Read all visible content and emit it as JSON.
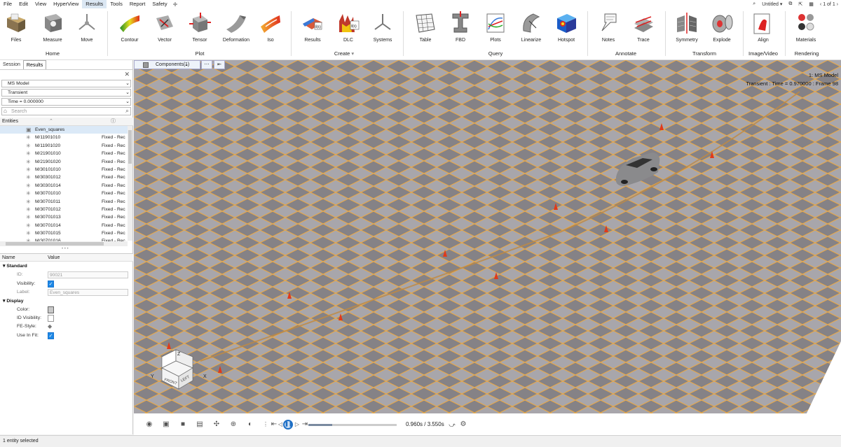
{
  "menu": {
    "items": [
      "File",
      "Edit",
      "View",
      "HyperView",
      "Results",
      "Tools",
      "Report",
      "Safety"
    ],
    "active_index": 4,
    "doc_title": "Untitled",
    "page_info": "1 of 1"
  },
  "ribbon": {
    "tools": [
      {
        "label": "Files",
        "icon": "folder-icon"
      },
      {
        "label": "Measure",
        "icon": "measure-icon"
      },
      {
        "label": "Move",
        "icon": "move-icon"
      },
      {
        "label": "Contour",
        "icon": "contour-icon"
      },
      {
        "label": "Vector",
        "icon": "vector-icon"
      },
      {
        "label": "Tensor",
        "icon": "tensor-icon"
      },
      {
        "label": "Deformation",
        "icon": "deformation-icon"
      },
      {
        "label": "Iso",
        "icon": "iso-icon"
      },
      {
        "label": "Results",
        "icon": "results-icon"
      },
      {
        "label": "DLC",
        "icon": "dlc-icon"
      },
      {
        "label": "Systems",
        "icon": "systems-icon"
      },
      {
        "label": "Table",
        "icon": "table-icon"
      },
      {
        "label": "FBD",
        "icon": "fbd-icon"
      },
      {
        "label": "Plots",
        "icon": "plots-icon"
      },
      {
        "label": "Linearize",
        "icon": "linearize-icon"
      },
      {
        "label": "Hotspot",
        "icon": "hotspot-icon"
      },
      {
        "label": "Notes",
        "icon": "notes-icon"
      },
      {
        "label": "Trace",
        "icon": "trace-icon"
      },
      {
        "label": "Symmetry",
        "icon": "symmetry-icon"
      },
      {
        "label": "Explode",
        "icon": "explode-icon"
      },
      {
        "label": "Align",
        "icon": "align-icon"
      },
      {
        "label": "Materials",
        "icon": "materials-icon"
      }
    ],
    "groups": [
      "Home",
      "Plot",
      "Create",
      "Query",
      "Annotate",
      "Transform",
      "Image/Video",
      "Rendering"
    ]
  },
  "left_panel": {
    "tabs": [
      "Session",
      "Results"
    ],
    "active_tab": 1,
    "model_select": "MS Model",
    "type_select": "Transient",
    "time_select": "Time = 0.000000",
    "search_placeholder": "Search",
    "entities_header": "Entities",
    "entities": [
      {
        "name": "Even_squares",
        "status": ""
      },
      {
        "name": "M/11901010",
        "status": "Fixed - Rec"
      },
      {
        "name": "M/11901020",
        "status": "Fixed - Rec"
      },
      {
        "name": "M/21901010",
        "status": "Fixed - Rec"
      },
      {
        "name": "M/21901020",
        "status": "Fixed - Rec"
      },
      {
        "name": "M/30101010",
        "status": "Fixed - Rec"
      },
      {
        "name": "M/30301012",
        "status": "Fixed - Rec"
      },
      {
        "name": "M/30301014",
        "status": "Fixed - Rec"
      },
      {
        "name": "M/30701010",
        "status": "Fixed - Rec"
      },
      {
        "name": "M/30701011",
        "status": "Fixed - Rec"
      },
      {
        "name": "M/30701012",
        "status": "Fixed - Rec"
      },
      {
        "name": "M/30701013",
        "status": "Fixed - Rec"
      },
      {
        "name": "M/30701014",
        "status": "Fixed - Rec"
      },
      {
        "name": "M/30701015",
        "status": "Fixed - Rec"
      },
      {
        "name": "M/30701016",
        "status": "Fixed - Rec"
      }
    ],
    "props_header": {
      "name": "Name",
      "value": "Value"
    },
    "standard_section": "Standard",
    "display_section": "Display",
    "id_label": "ID:",
    "id_value": "90021",
    "visibility_label": "Visibility:",
    "label_label": "Label:",
    "label_value": "Even_squares",
    "color_label": "Color:",
    "id_visibility_label": "ID Visibility:",
    "fe_style_label": "FE-Style:",
    "use_in_fit_label": "Use In Fit:"
  },
  "viewport": {
    "components_tab": "Components(1)",
    "model_name": "1: MS Model",
    "frame_info": "Transient : Time = 0.970000 : Frame 98",
    "time_display": "0.960s / 3.550s",
    "progress": 0.27,
    "axis_labels": {
      "z": "Z",
      "y": "Y",
      "x": "X"
    },
    "cube_faces": {
      "front": "FRONT",
      "left": "LEFT"
    }
  },
  "status_bar": "1 entity selected"
}
